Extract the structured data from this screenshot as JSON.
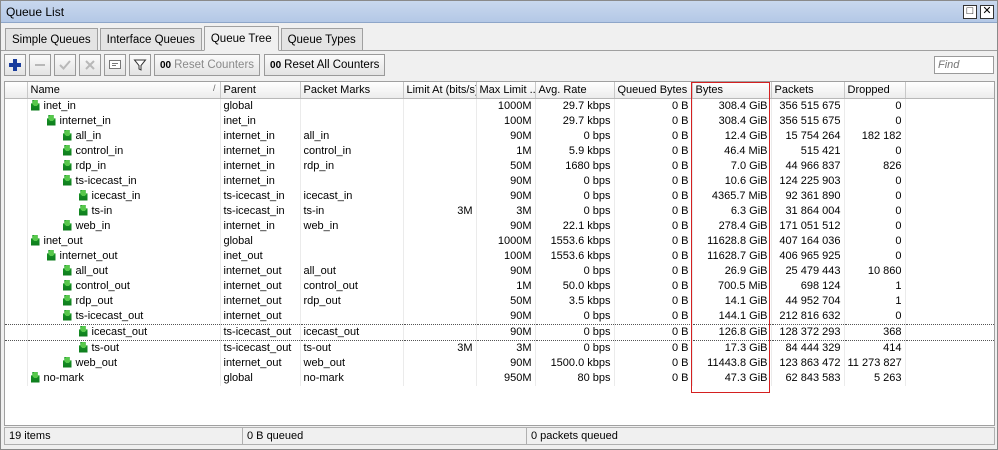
{
  "window": {
    "title": "Queue List"
  },
  "tabs": [
    {
      "label": "Simple Queues",
      "active": false
    },
    {
      "label": "Interface Queues",
      "active": false
    },
    {
      "label": "Queue Tree",
      "active": true
    },
    {
      "label": "Queue Types",
      "active": false
    }
  ],
  "toolbar": {
    "reset_counters": "Reset Counters",
    "reset_all_counters": "Reset All Counters",
    "counter_badge": "00",
    "find_placeholder": "Find"
  },
  "table": {
    "columns": [
      "Name",
      "Parent",
      "Packet Marks",
      "Limit At (bits/s)",
      "Max Limit ...",
      "Avg. Rate",
      "Queued Bytes",
      "Bytes",
      "Packets",
      "Dropped"
    ],
    "sort_indicator": "/",
    "rows": [
      {
        "indent": 0,
        "name": "inet_in",
        "parent": "global",
        "marks": "",
        "limit_at": "",
        "max_limit": "1000M",
        "avg_rate": "29.7 kbps",
        "queued": "0 B",
        "bytes": "308.4 GiB",
        "packets": "356 515 675",
        "dropped": "0"
      },
      {
        "indent": 1,
        "name": "internet_in",
        "parent": "inet_in",
        "marks": "",
        "limit_at": "",
        "max_limit": "100M",
        "avg_rate": "29.7 kbps",
        "queued": "0 B",
        "bytes": "308.4 GiB",
        "packets": "356 515 675",
        "dropped": "0"
      },
      {
        "indent": 2,
        "name": "all_in",
        "parent": "internet_in",
        "marks": "all_in",
        "limit_at": "",
        "max_limit": "90M",
        "avg_rate": "0 bps",
        "queued": "0 B",
        "bytes": "12.4 GiB",
        "packets": "15 754 264",
        "dropped": "182 182"
      },
      {
        "indent": 2,
        "name": "control_in",
        "parent": "internet_in",
        "marks": "control_in",
        "limit_at": "",
        "max_limit": "1M",
        "avg_rate": "5.9 kbps",
        "queued": "0 B",
        "bytes": "46.4 MiB",
        "packets": "515 421",
        "dropped": "0"
      },
      {
        "indent": 2,
        "name": "rdp_in",
        "parent": "internet_in",
        "marks": "rdp_in",
        "limit_at": "",
        "max_limit": "50M",
        "avg_rate": "1680 bps",
        "queued": "0 B",
        "bytes": "7.0 GiB",
        "packets": "44 966 837",
        "dropped": "826"
      },
      {
        "indent": 2,
        "name": "ts-icecast_in",
        "parent": "internet_in",
        "marks": "",
        "limit_at": "",
        "max_limit": "90M",
        "avg_rate": "0 bps",
        "queued": "0 B",
        "bytes": "10.6 GiB",
        "packets": "124 225 903",
        "dropped": "0"
      },
      {
        "indent": 3,
        "name": "icecast_in",
        "parent": "ts-icecast_in",
        "marks": "icecast_in",
        "limit_at": "",
        "max_limit": "90M",
        "avg_rate": "0 bps",
        "queued": "0 B",
        "bytes": "4365.7 MiB",
        "packets": "92 361 890",
        "dropped": "0"
      },
      {
        "indent": 3,
        "name": "ts-in",
        "parent": "ts-icecast_in",
        "marks": "ts-in",
        "limit_at": "3M",
        "max_limit": "3M",
        "avg_rate": "0 bps",
        "queued": "0 B",
        "bytes": "6.3 GiB",
        "packets": "31 864 004",
        "dropped": "0"
      },
      {
        "indent": 2,
        "name": "web_in",
        "parent": "internet_in",
        "marks": "web_in",
        "limit_at": "",
        "max_limit": "90M",
        "avg_rate": "22.1 kbps",
        "queued": "0 B",
        "bytes": "278.4 GiB",
        "packets": "171 051 512",
        "dropped": "0"
      },
      {
        "indent": 0,
        "name": "inet_out",
        "parent": "global",
        "marks": "",
        "limit_at": "",
        "max_limit": "1000M",
        "avg_rate": "1553.6 kbps",
        "queued": "0 B",
        "bytes": "11628.8 GiB",
        "packets": "407 164 036",
        "dropped": "0"
      },
      {
        "indent": 1,
        "name": "internet_out",
        "parent": "inet_out",
        "marks": "",
        "limit_at": "",
        "max_limit": "100M",
        "avg_rate": "1553.6 kbps",
        "queued": "0 B",
        "bytes": "11628.7 GiB",
        "packets": "406 965 925",
        "dropped": "0"
      },
      {
        "indent": 2,
        "name": "all_out",
        "parent": "internet_out",
        "marks": "all_out",
        "limit_at": "",
        "max_limit": "90M",
        "avg_rate": "0 bps",
        "queued": "0 B",
        "bytes": "26.9 GiB",
        "packets": "25 479 443",
        "dropped": "10 860"
      },
      {
        "indent": 2,
        "name": "control_out",
        "parent": "internet_out",
        "marks": "control_out",
        "limit_at": "",
        "max_limit": "1M",
        "avg_rate": "50.0 kbps",
        "queued": "0 B",
        "bytes": "700.5 MiB",
        "packets": "698 124",
        "dropped": "1"
      },
      {
        "indent": 2,
        "name": "rdp_out",
        "parent": "internet_out",
        "marks": "rdp_out",
        "limit_at": "",
        "max_limit": "50M",
        "avg_rate": "3.5 kbps",
        "queued": "0 B",
        "bytes": "14.1 GiB",
        "packets": "44 952 704",
        "dropped": "1"
      },
      {
        "indent": 2,
        "name": "ts-icecast_out",
        "parent": "internet_out",
        "marks": "",
        "limit_at": "",
        "max_limit": "90M",
        "avg_rate": "0 bps",
        "queued": "0 B",
        "bytes": "144.1 GiB",
        "packets": "212 816 632",
        "dropped": "0"
      },
      {
        "indent": 3,
        "name": "icecast_out",
        "parent": "ts-icecast_out",
        "marks": "icecast_out",
        "limit_at": "",
        "max_limit": "90M",
        "avg_rate": "0 bps",
        "queued": "0 B",
        "bytes": "126.8 GiB",
        "packets": "128 372 293",
        "dropped": "368",
        "selected": true
      },
      {
        "indent": 3,
        "name": "ts-out",
        "parent": "ts-icecast_out",
        "marks": "ts-out",
        "limit_at": "3M",
        "max_limit": "3M",
        "avg_rate": "0 bps",
        "queued": "0 B",
        "bytes": "17.3 GiB",
        "packets": "84 444 329",
        "dropped": "414"
      },
      {
        "indent": 2,
        "name": "web_out",
        "parent": "internet_out",
        "marks": "web_out",
        "limit_at": "",
        "max_limit": "90M",
        "avg_rate": "1500.0 kbps",
        "queued": "0 B",
        "bytes": "11443.8 GiB",
        "packets": "123 863 472",
        "dropped": "11 273 827"
      },
      {
        "indent": 0,
        "name": "no-mark",
        "parent": "global",
        "marks": "no-mark",
        "limit_at": "",
        "max_limit": "950M",
        "avg_rate": "80 bps",
        "queued": "0 B",
        "bytes": "47.3 GiB",
        "packets": "62 843 583",
        "dropped": "5 263"
      }
    ]
  },
  "status": {
    "items": "19 items",
    "queued_bytes": "0 B queued",
    "queued_packets": "0 packets queued"
  }
}
